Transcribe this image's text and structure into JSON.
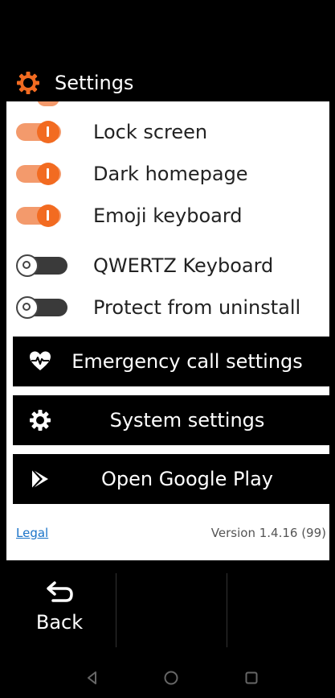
{
  "header": {
    "title": "Settings",
    "icon": "gear-icon",
    "accent": "#f26b21"
  },
  "toggles": [
    {
      "label": "Lock screen",
      "state": "on"
    },
    {
      "label": "Dark homepage",
      "state": "on"
    },
    {
      "label": "Emoji keyboard",
      "state": "on"
    },
    {
      "label": "QWERTZ Keyboard",
      "state": "off"
    },
    {
      "label": "Protect from uninstall",
      "state": "off"
    }
  ],
  "actions": [
    {
      "label": "Emergency call settings",
      "icon": "heart-pulse-icon"
    },
    {
      "label": "System settings",
      "icon": "gear-icon"
    },
    {
      "label": "Open Google Play",
      "icon": "play-store-icon"
    }
  ],
  "footer": {
    "legal": "Legal",
    "version": "Version 1.4.16 (99)"
  },
  "bottom": {
    "back_label": "Back",
    "back_icon": "back-arrow-icon"
  },
  "nav": {
    "keys": [
      "triangle-back-icon",
      "circle-home-icon",
      "square-recents-icon"
    ]
  },
  "colors": {
    "toggle_on_thumb": "#f26b21",
    "toggle_on_track": "#f39a6c",
    "toggle_off_track": "#3a3a3a",
    "link": "#1a73c8"
  }
}
